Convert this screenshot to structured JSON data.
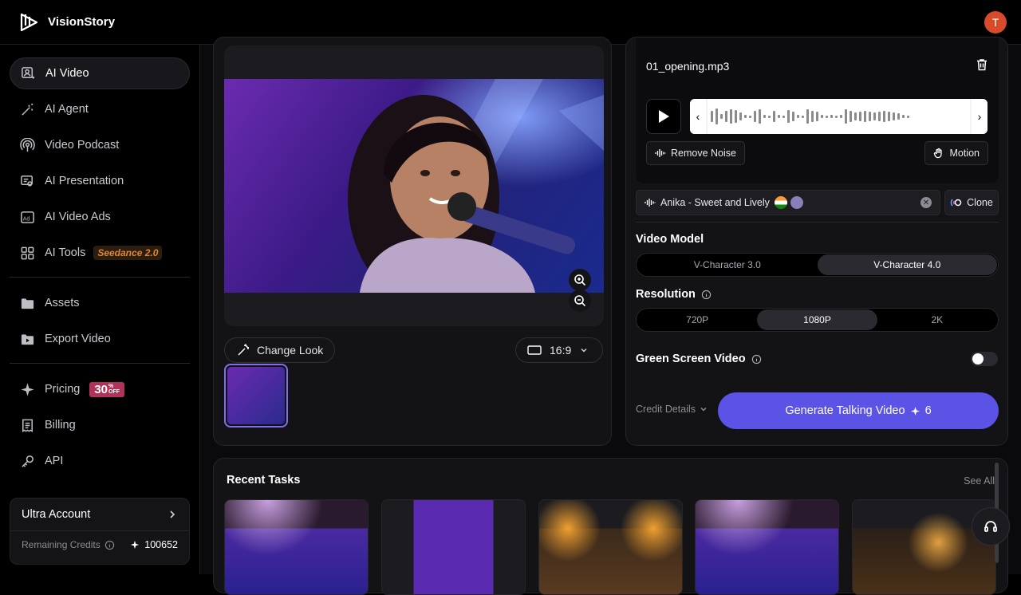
{
  "brand": {
    "name": "VisionStory"
  },
  "user": {
    "initial": "T",
    "avatar_color": "#d94a2a"
  },
  "sidebar": {
    "items": [
      {
        "label": "AI Video",
        "icon": "ai-video-icon",
        "active": true
      },
      {
        "label": "AI Agent",
        "icon": "magic-wand-icon"
      },
      {
        "label": "Video Podcast",
        "icon": "podcast-icon"
      },
      {
        "label": "AI Presentation",
        "icon": "presentation-icon"
      },
      {
        "label": "AI Video Ads",
        "icon": "ads-icon"
      },
      {
        "label": "AI Tools",
        "icon": "grid-icon",
        "badge": "Seedance 2.0"
      }
    ],
    "items2": [
      {
        "label": "Assets",
        "icon": "folder-icon"
      },
      {
        "label": "Export Video",
        "icon": "export-folder-icon"
      }
    ],
    "items3": [
      {
        "label": "Pricing",
        "icon": "sparkle-icon",
        "badge_main": "30",
        "badge_pct": "%",
        "badge_off": "OFF"
      },
      {
        "label": "Billing",
        "icon": "receipt-icon"
      },
      {
        "label": "API",
        "icon": "key-icon"
      }
    ],
    "account": {
      "title": "Ultra Account",
      "credits_label": "Remaining Credits",
      "credits_value": "100652"
    }
  },
  "editor": {
    "change_look": "Change Look",
    "aspect_ratio": "16:9"
  },
  "audio": {
    "file_name": "01_opening.mp3",
    "remove_noise": "Remove Noise",
    "motion": "Motion",
    "voice_name": "Anika - Sweet and Lively",
    "clone": "Clone"
  },
  "video_model": {
    "title": "Video Model",
    "options": [
      "V-Character 3.0",
      "V-Character 4.0"
    ],
    "selected": 1
  },
  "resolution": {
    "title": "Resolution",
    "options": [
      "720P",
      "1080P",
      "2K"
    ],
    "selected": 1
  },
  "green_screen": {
    "title": "Green Screen Video",
    "enabled": false
  },
  "generate": {
    "credit_details": "Credit Details",
    "label": "Generate Talking Video",
    "cost": "6",
    "color": "#5b52e6"
  },
  "recent": {
    "title": "Recent Tasks",
    "see_all": "See All"
  }
}
